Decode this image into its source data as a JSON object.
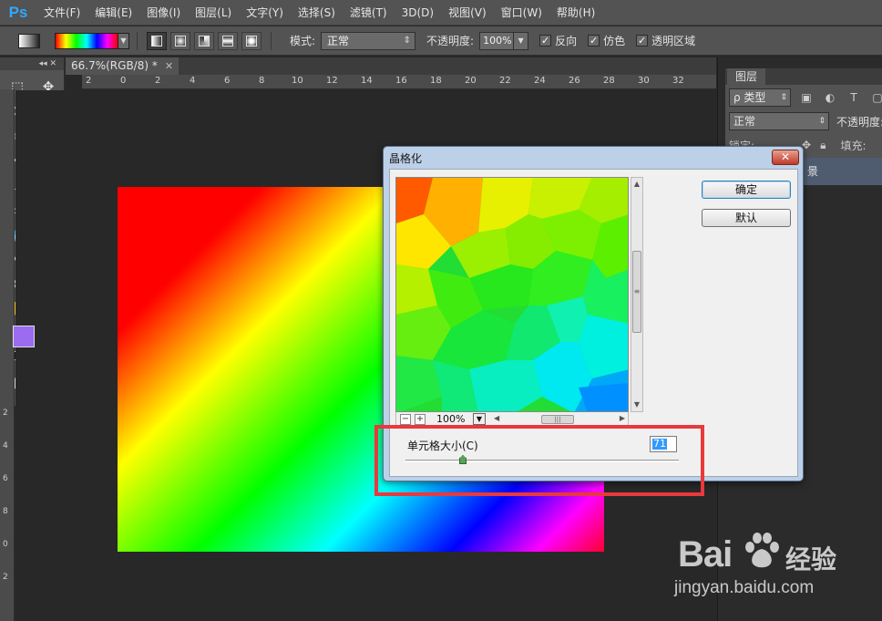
{
  "app": {
    "logo": "Ps"
  },
  "menu": [
    "文件(F)",
    "编辑(E)",
    "图像(I)",
    "图层(L)",
    "文字(Y)",
    "选择(S)",
    "滤镜(T)",
    "3D(D)",
    "视图(V)",
    "窗口(W)",
    "帮助(H)"
  ],
  "options": {
    "mode_label": "模式:",
    "mode_value": "正常",
    "opacity_label": "不透明度:",
    "opacity_value": "100%",
    "reverse_label": "反向",
    "dither_label": "仿色",
    "transparency_label": "透明区域"
  },
  "document": {
    "tab_title": "66.7%(RGB/8) *"
  },
  "ruler": {
    "top": [
      "2",
      "0",
      "2",
      "4",
      "6",
      "8",
      "10",
      "12",
      "14",
      "16",
      "18",
      "20",
      "22",
      "24",
      "26",
      "28",
      "30",
      "32"
    ],
    "left": [
      "2",
      "4",
      "6",
      "8",
      "0",
      "2"
    ]
  },
  "layers_panel": {
    "tab": "图层",
    "kind_label": "ρ 类型",
    "blend_mode": "正常",
    "opacity_label": "不透明度:",
    "lock_label": "锁定:",
    "fill_label": "填充:",
    "layer_name": "景"
  },
  "dialog": {
    "title": "晶格化",
    "ok_label": "确定",
    "default_label": "默认",
    "zoom_value": "100%",
    "cell_size_label": "单元格大小(C)",
    "cell_size_value": "71",
    "cell_size_fraction": 0.21
  },
  "watermark": {
    "brand": "Bai",
    "brand_cn": "经验",
    "url": "jingyan.baidu.com"
  },
  "colors": {
    "foreground": "#9b6cf0",
    "background": "#ffffff",
    "highlight": "#e8393c",
    "ps_blue": "#31a8ff"
  }
}
